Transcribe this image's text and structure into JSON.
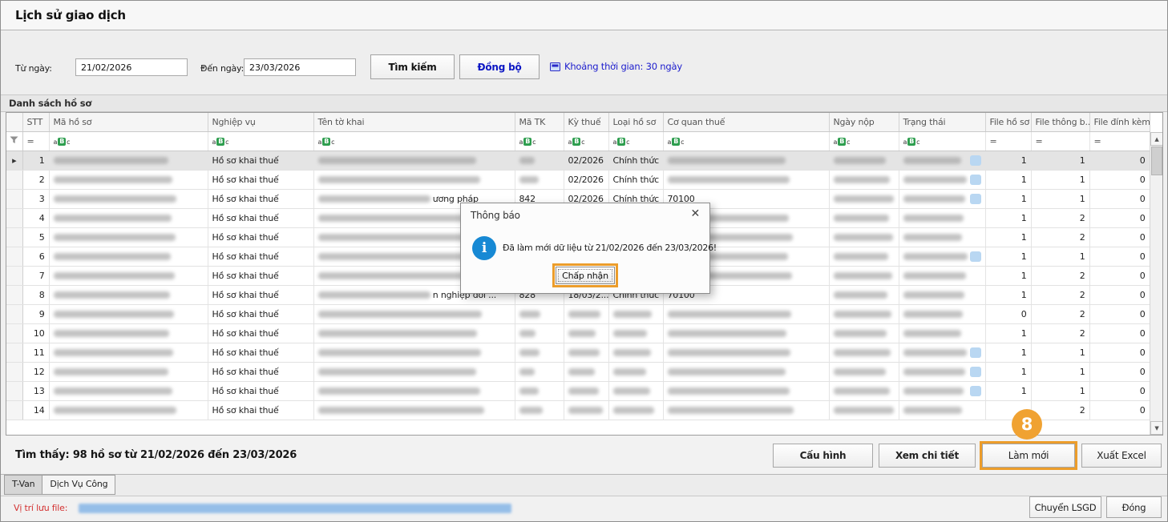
{
  "window": {
    "title": "Lịch sử giao dịch"
  },
  "search": {
    "from_label": "Từ ngày:",
    "from_value": "21/02/2026",
    "to_label": "Đến ngày:",
    "to_value": "23/03/2026",
    "search_button": "Tìm kiếm",
    "sync_button": "Đồng bộ",
    "range_link": "Khoảng thời gian: 30 ngày"
  },
  "grid": {
    "section_title": "Danh sách hồ sơ",
    "columns": [
      "STT",
      "Mã hồ sơ",
      "Nghiệp vụ",
      "Tên tờ khai",
      "Mã TK",
      "Kỳ thuế",
      "Loại hồ sơ",
      "Cơ quan thuế",
      "Ngày nộp",
      "Trạng thái",
      "File hồ sơ",
      "File thông b...",
      "File đính kèm"
    ],
    "filter": {
      "equals_symbol": "=",
      "text_filter_icon": "aBc"
    },
    "rows": [
      {
        "stt": "1",
        "selected": true,
        "ma_ho_so": null,
        "nghiep_vu": "Hồ sơ khai thuế",
        "ten_to_khai": null,
        "ten_tail": null,
        "ma_tk": null,
        "ky_thue": "02/2026",
        "loai_ho_so": "Chính thức",
        "co_quan_thue": null,
        "ngay_nop": null,
        "trang_thai": null,
        "has_status_icon": true,
        "file_ho_so": "1",
        "file_thong_bao": "1",
        "file_dinh_kem": "0"
      },
      {
        "stt": "2",
        "selected": false,
        "ma_ho_so": null,
        "nghiep_vu": "Hồ sơ khai thuế",
        "ten_to_khai": null,
        "ten_tail": null,
        "ma_tk": null,
        "ky_thue": "02/2026",
        "loai_ho_so": "Chính thức",
        "co_quan_thue": null,
        "ngay_nop": null,
        "trang_thai": null,
        "has_status_icon": true,
        "file_ho_so": "1",
        "file_thong_bao": "1",
        "file_dinh_kem": "0"
      },
      {
        "stt": "3",
        "selected": false,
        "ma_ho_so": null,
        "nghiep_vu": "Hồ sơ khai thuế",
        "ten_to_khai": null,
        "ten_tail": "ương pháp",
        "ma_tk": "842",
        "ky_thue": "02/2026",
        "loai_ho_so": "Chính thức",
        "co_quan_thue": "70100",
        "ngay_nop": null,
        "trang_thai": null,
        "has_status_icon": true,
        "file_ho_so": "1",
        "file_thong_bao": "1",
        "file_dinh_kem": "0"
      },
      {
        "stt": "4",
        "selected": false,
        "ma_ho_so": null,
        "nghiep_vu": "Hồ sơ khai thuế",
        "ten_to_khai": null,
        "ten_tail": null,
        "ma_tk": null,
        "ky_thue": null,
        "loai_ho_so": null,
        "co_quan_thue": null,
        "ngay_nop": null,
        "trang_thai": null,
        "has_status_icon": false,
        "file_ho_so": "1",
        "file_thong_bao": "2",
        "file_dinh_kem": "0"
      },
      {
        "stt": "5",
        "selected": false,
        "ma_ho_so": null,
        "nghiep_vu": "Hồ sơ khai thuế",
        "ten_to_khai": null,
        "ten_tail": null,
        "ma_tk": null,
        "ky_thue": null,
        "loai_ho_so": null,
        "co_quan_thue": null,
        "ngay_nop": null,
        "trang_thai": null,
        "has_status_icon": false,
        "file_ho_so": "1",
        "file_thong_bao": "2",
        "file_dinh_kem": "0"
      },
      {
        "stt": "6",
        "selected": false,
        "ma_ho_so": null,
        "nghiep_vu": "Hồ sơ khai thuế",
        "ten_to_khai": null,
        "ten_tail": null,
        "ma_tk": null,
        "ky_thue": null,
        "loai_ho_so": null,
        "co_quan_thue": null,
        "ngay_nop": null,
        "trang_thai": null,
        "has_status_icon": true,
        "file_ho_so": "1",
        "file_thong_bao": "1",
        "file_dinh_kem": "0"
      },
      {
        "stt": "7",
        "selected": false,
        "ma_ho_so": null,
        "nghiep_vu": "Hồ sơ khai thuế",
        "ten_to_khai": null,
        "ten_tail": null,
        "ma_tk": null,
        "ky_thue": null,
        "loai_ho_so": null,
        "co_quan_thue": null,
        "ngay_nop": null,
        "trang_thai": null,
        "has_status_icon": false,
        "file_ho_so": "1",
        "file_thong_bao": "2",
        "file_dinh_kem": "0"
      },
      {
        "stt": "8",
        "selected": false,
        "ma_ho_so": null,
        "nghiep_vu": "Hồ sơ khai thuế",
        "ten_to_khai": null,
        "ten_tail": "n nghiệp đổi ...",
        "ma_tk": "828",
        "ky_thue": "18/03/2...",
        "loai_ho_so": "Chính thức",
        "co_quan_thue": "70100",
        "ngay_nop": null,
        "trang_thai": null,
        "has_status_icon": false,
        "file_ho_so": "1",
        "file_thong_bao": "2",
        "file_dinh_kem": "0"
      },
      {
        "stt": "9",
        "selected": false,
        "ma_ho_so": null,
        "nghiep_vu": "Hồ sơ khai thuế",
        "ten_to_khai": null,
        "ten_tail": null,
        "ma_tk": null,
        "ky_thue": null,
        "loai_ho_so": null,
        "co_quan_thue": null,
        "ngay_nop": null,
        "trang_thai": null,
        "has_status_icon": false,
        "file_ho_so": "0",
        "file_thong_bao": "2",
        "file_dinh_kem": "0"
      },
      {
        "stt": "10",
        "selected": false,
        "ma_ho_so": null,
        "nghiep_vu": "Hồ sơ khai thuế",
        "ten_to_khai": null,
        "ten_tail": null,
        "ma_tk": null,
        "ky_thue": null,
        "loai_ho_so": null,
        "co_quan_thue": null,
        "ngay_nop": null,
        "trang_thai": null,
        "has_status_icon": false,
        "file_ho_so": "1",
        "file_thong_bao": "2",
        "file_dinh_kem": "0"
      },
      {
        "stt": "11",
        "selected": false,
        "ma_ho_so": null,
        "nghiep_vu": "Hồ sơ khai thuế",
        "ten_to_khai": null,
        "ten_tail": null,
        "ma_tk": null,
        "ky_thue": null,
        "loai_ho_so": null,
        "co_quan_thue": null,
        "ngay_nop": null,
        "trang_thai": null,
        "has_status_icon": true,
        "file_ho_so": "1",
        "file_thong_bao": "1",
        "file_dinh_kem": "0"
      },
      {
        "stt": "12",
        "selected": false,
        "ma_ho_so": null,
        "nghiep_vu": "Hồ sơ khai thuế",
        "ten_to_khai": null,
        "ten_tail": null,
        "ma_tk": null,
        "ky_thue": null,
        "loai_ho_so": null,
        "co_quan_thue": null,
        "ngay_nop": null,
        "trang_thai": null,
        "has_status_icon": true,
        "file_ho_so": "1",
        "file_thong_bao": "1",
        "file_dinh_kem": "0"
      },
      {
        "stt": "13",
        "selected": false,
        "ma_ho_so": null,
        "nghiep_vu": "Hồ sơ khai thuế",
        "ten_to_khai": null,
        "ten_tail": null,
        "ma_tk": null,
        "ky_thue": null,
        "loai_ho_so": null,
        "co_quan_thue": null,
        "ngay_nop": null,
        "trang_thai": null,
        "has_status_icon": true,
        "file_ho_so": "1",
        "file_thong_bao": "1",
        "file_dinh_kem": "0"
      },
      {
        "stt": "14",
        "selected": false,
        "ma_ho_so": null,
        "nghiep_vu": "Hồ sơ khai thuế",
        "ten_to_khai": null,
        "ten_tail": null,
        "ma_tk": null,
        "ky_thue": null,
        "loai_ho_so": null,
        "co_quan_thue": null,
        "ngay_nop": null,
        "trang_thai": null,
        "has_status_icon": false,
        "file_ho_so": null,
        "file_thong_bao": "2",
        "file_dinh_kem": "0"
      }
    ]
  },
  "dialog": {
    "title": "Thông báo",
    "message": "Đã làm mới dữ liệu từ 21/02/2026 đến 23/03/2026!",
    "accept_button": "Chấp nhận"
  },
  "status": {
    "summary": "Tìm thấy: 98 hồ sơ từ 21/02/2026 đến 23/03/2026",
    "config_button": "Cấu hình",
    "detail_button": "Xem chi tiết",
    "refresh_button": "Làm mới",
    "export_button": "Xuất Excel",
    "step_badge": "8"
  },
  "tabs": [
    {
      "label": "T-Van",
      "active": true
    },
    {
      "label": "Dịch Vụ Công",
      "active": false
    }
  ],
  "footer": {
    "file_location_label": "Vị trí lưu file:",
    "transfer_button": "Chuyển LSGD",
    "close_button": "Đóng"
  },
  "icons": {
    "close": "✕",
    "info": "i",
    "scroll_up": "▲",
    "scroll_down": "▼",
    "dropdown": "▾",
    "row_arrow": "▸"
  },
  "colors": {
    "accent_orange": "#EC9D2B",
    "info_blue": "#1789D4",
    "link_blue": "#1C1CCD",
    "filter_green": "#2E9E4F"
  }
}
